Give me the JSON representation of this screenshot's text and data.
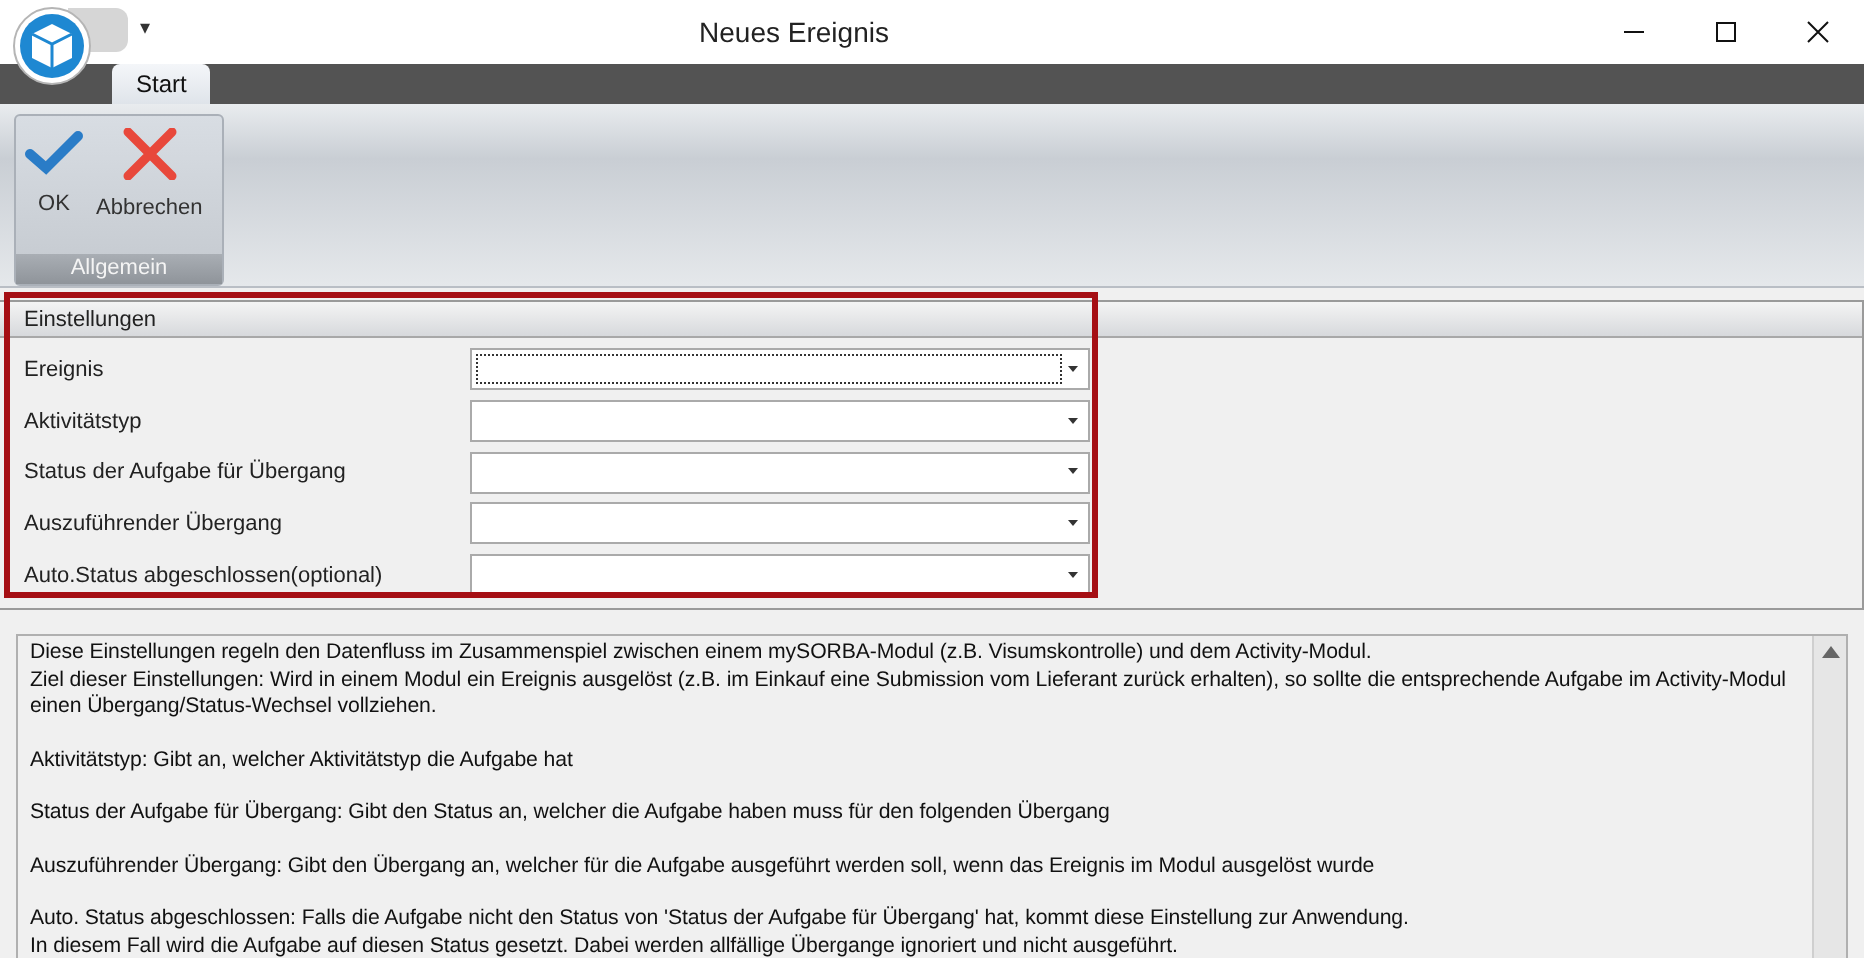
{
  "window": {
    "title": "Neues Ereignis",
    "quick_access": "▾"
  },
  "tabs": [
    {
      "label": "Start",
      "selected": true
    }
  ],
  "ribbon_groups": [
    {
      "label": "Allgemein",
      "buttons": [
        {
          "label": "OK",
          "kind": "ok"
        },
        {
          "label": "Abbrechen",
          "kind": "cancel"
        }
      ]
    }
  ],
  "settings": {
    "title": "Einstellungen",
    "highlighted": true,
    "fields": [
      {
        "label": "Ereignis",
        "focused": true
      },
      {
        "label": "Aktivitätstyp",
        "focused": false
      },
      {
        "label": "Status der Aufgabe für Übergang",
        "focused": false
      },
      {
        "label": "Auszuführender Übergang",
        "focused": false
      },
      {
        "label": "Auto.Status abgeschlossen(optional)",
        "focused": false
      }
    ]
  },
  "description": [
    [
      "Diese Einstellungen regeln den Datenfluss im Zusammenspiel zwischen einem mySORBA-Modul (z.B. Visumskontrolle) und dem Activity-Modul.",
      "Ziel dieser Einstellungen: Wird in einem Modul ein Ereignis ausgelöst (z.B. im Einkauf eine Submission vom Lieferant zurück erhalten), so sollte die entsprechende Aufgabe im Activity-Modul",
      "einen Übergang/Status-Wechsel vollziehen."
    ],
    [
      "Aktivitätstyp: Gibt an, welcher Aktivitätstyp die Aufgabe hat"
    ],
    [
      "Status der Aufgabe für Übergang: Gibt den Status an, welcher die Aufgabe haben muss für den folgenden Übergang"
    ],
    [
      "Auszuführender Übergang: Gibt den Übergang an, welcher für die Aufgabe ausgeführt werden soll, wenn das Ereignis im Modul ausgelöst wurde"
    ],
    [
      "Auto. Status abgeschlossen: Falls die Aufgabe nicht den Status von 'Status der Aufgabe für Übergang' hat, kommt diese Einstellung zur Anwendung.",
      "In diesem Fall wird die Aufgabe auf diesen Status gesetzt. Dabei werden allfällige Übergange ignoriert und nicht ausgeführt."
    ]
  ]
}
